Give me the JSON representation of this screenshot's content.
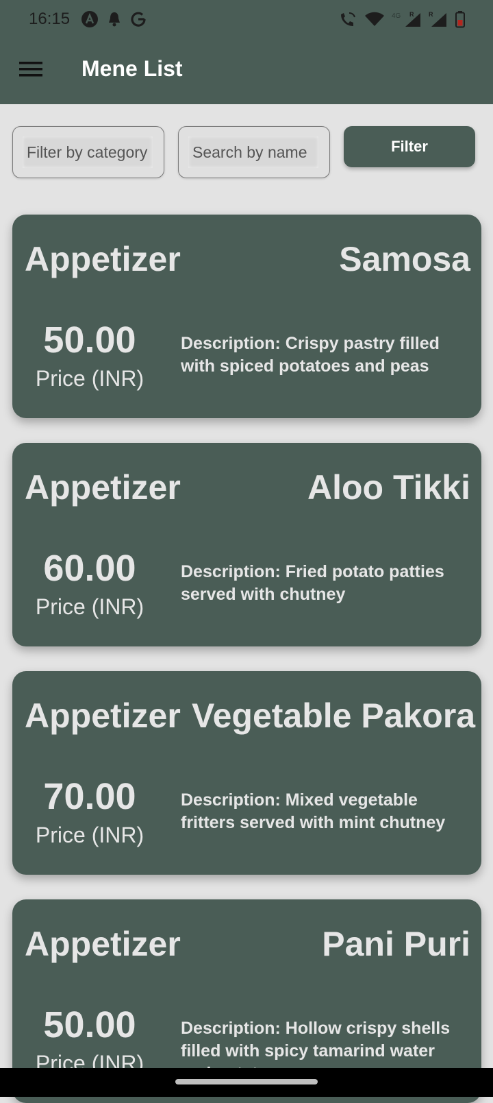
{
  "status_bar": {
    "time": "16:15",
    "left_icons": [
      "app-logo-icon",
      "notification-bell-icon",
      "google-g-icon"
    ],
    "right_icons": [
      "wifi-call-icon",
      "wifi-icon",
      "signal-4g-icon",
      "signal-icon",
      "battery-icon"
    ],
    "network_label": "4G",
    "roaming_label": "R"
  },
  "app_bar": {
    "title": "Mene List",
    "menu_icon": "hamburger-menu-icon"
  },
  "filters": {
    "category_placeholder": "Filter by category",
    "name_placeholder": "Search by name",
    "filter_label": "Filter"
  },
  "menu_items": [
    {
      "category": "Appetizer",
      "name": "Samosa",
      "price": "50.00",
      "price_label": "Price (INR)",
      "description": "Description: Crispy pastry filled with spiced potatoes and peas"
    },
    {
      "category": "Appetizer",
      "name": "Aloo Tikki",
      "price": "60.00",
      "price_label": "Price (INR)",
      "description": "Description: Fried potato patties served with chutney"
    },
    {
      "category": "Appetizer",
      "name": "Vegetable Pakora",
      "price": "70.00",
      "price_label": "Price (INR)",
      "description": "Description: Mixed vegetable fritters served with mint chutney"
    },
    {
      "category": "Appetizer",
      "name": "Pani Puri",
      "price": "50.00",
      "price_label": "Price (INR)",
      "description": "Description: Hollow crispy shells filled with spicy tamarind water and potatoes"
    }
  ],
  "colors": {
    "primary": "#4a5d56",
    "background": "#e3e3e3",
    "card_text": "#e6e6e6"
  }
}
